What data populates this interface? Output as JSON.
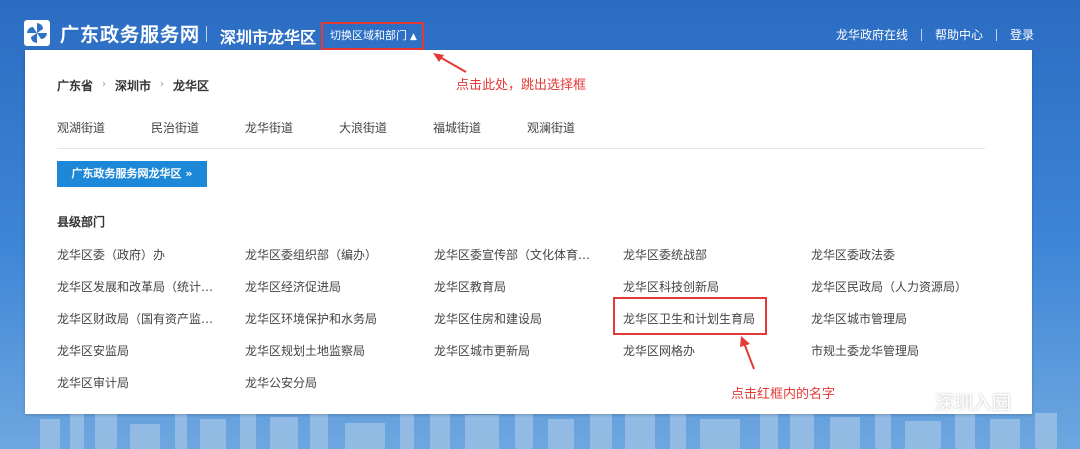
{
  "header": {
    "brand": "广东政务服务网",
    "region": "深圳市龙华区",
    "switch_label": "切换区域和部门",
    "nav": [
      "龙华政府在线",
      "帮助中心",
      "登录"
    ]
  },
  "annotations": {
    "switch_hint": "点击此处，跳出选择框",
    "dept_hint": "点击红框内的名字"
  },
  "breadcrumb": [
    "广东省",
    "深圳市",
    "龙华区"
  ],
  "streets": [
    "观湖街道",
    "民治街道",
    "龙华街道",
    "大浪街道",
    "福城街道",
    "观澜街道"
  ],
  "portal_button": "广东政务服务网龙华区 »",
  "county_section_title": "县级部门",
  "departments": [
    [
      "龙华区委（政府）办",
      "龙华区委组织部（编办）",
      "龙华区委宣传部（文化体育…",
      "龙华区委统战部",
      "龙华区委政法委"
    ],
    [
      "龙华区发展和改革局（统计…",
      "龙华区经济促进局",
      "龙华区教育局",
      "龙华区科技创新局",
      "龙华区民政局（人力资源局）"
    ],
    [
      "龙华区财政局（国有资产监…",
      "龙华区环境保护和水务局",
      "龙华区住房和建设局",
      "龙华区卫生和计划生育局",
      "龙华区城市管理局"
    ],
    [
      "龙华区安监局",
      "龙华区规划土地监察局",
      "龙华区城市更新局",
      "龙华区网格办",
      "市规土委龙华管理局"
    ],
    [
      "龙华区审计局",
      "龙华公安分局"
    ]
  ],
  "watermark": "深圳入园",
  "colors": {
    "header_blue": "#2f72c4",
    "highlight_red": "#e53935",
    "button_blue": "#1e88d8"
  }
}
